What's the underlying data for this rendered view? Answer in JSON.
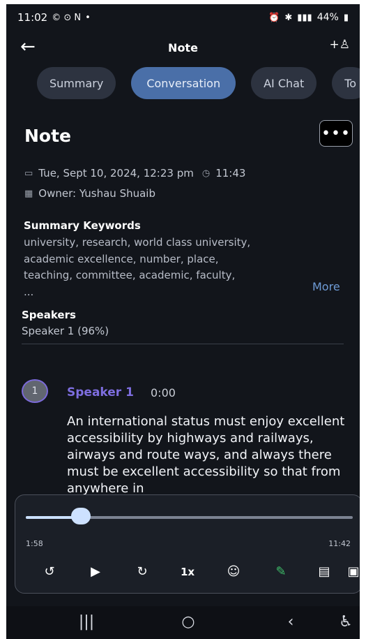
{
  "status_bar": {
    "time": "11:02",
    "left_icons": "© ⊙ N",
    "dot": "•",
    "battery": "44%"
  },
  "header": {
    "title": "Note"
  },
  "tabs": [
    {
      "label": "Summary",
      "active": false
    },
    {
      "label": "Conversation",
      "active": true
    },
    {
      "label": "AI Chat",
      "active": false
    },
    {
      "label": "To",
      "active": false
    }
  ],
  "note": {
    "heading": "Note",
    "date": "Tue, Sept 10, 2024, 12:23 pm",
    "duration": "11:43",
    "owner": "Owner: Yushau Shuaib"
  },
  "keywords": {
    "title": "Summary Keywords",
    "line1": "university,  research,  world class university,",
    "line2": "academic excellence,  number,  place,",
    "line3": "teaching,  committee,  academic,  faculty,",
    "line4": "...",
    "more_label": "More"
  },
  "speakers": {
    "title": "Speakers",
    "summary": "Speaker 1 (96%)"
  },
  "segment": {
    "avatar": "1",
    "speaker": "Speaker 1",
    "time": "0:00",
    "text": "An international status must enjoy excellent accessibility by highways and railways, airways and route ways, and always there must be excellent accessibility so that from anywhere in"
  },
  "player": {
    "current": "1:58",
    "total": "11:42",
    "progress": 0.168,
    "speed": "1x"
  },
  "colors": {
    "accent": "#4a6fa8",
    "speaker": "#7e6ee0",
    "link": "#6e9bd6",
    "background": "#12151b"
  }
}
